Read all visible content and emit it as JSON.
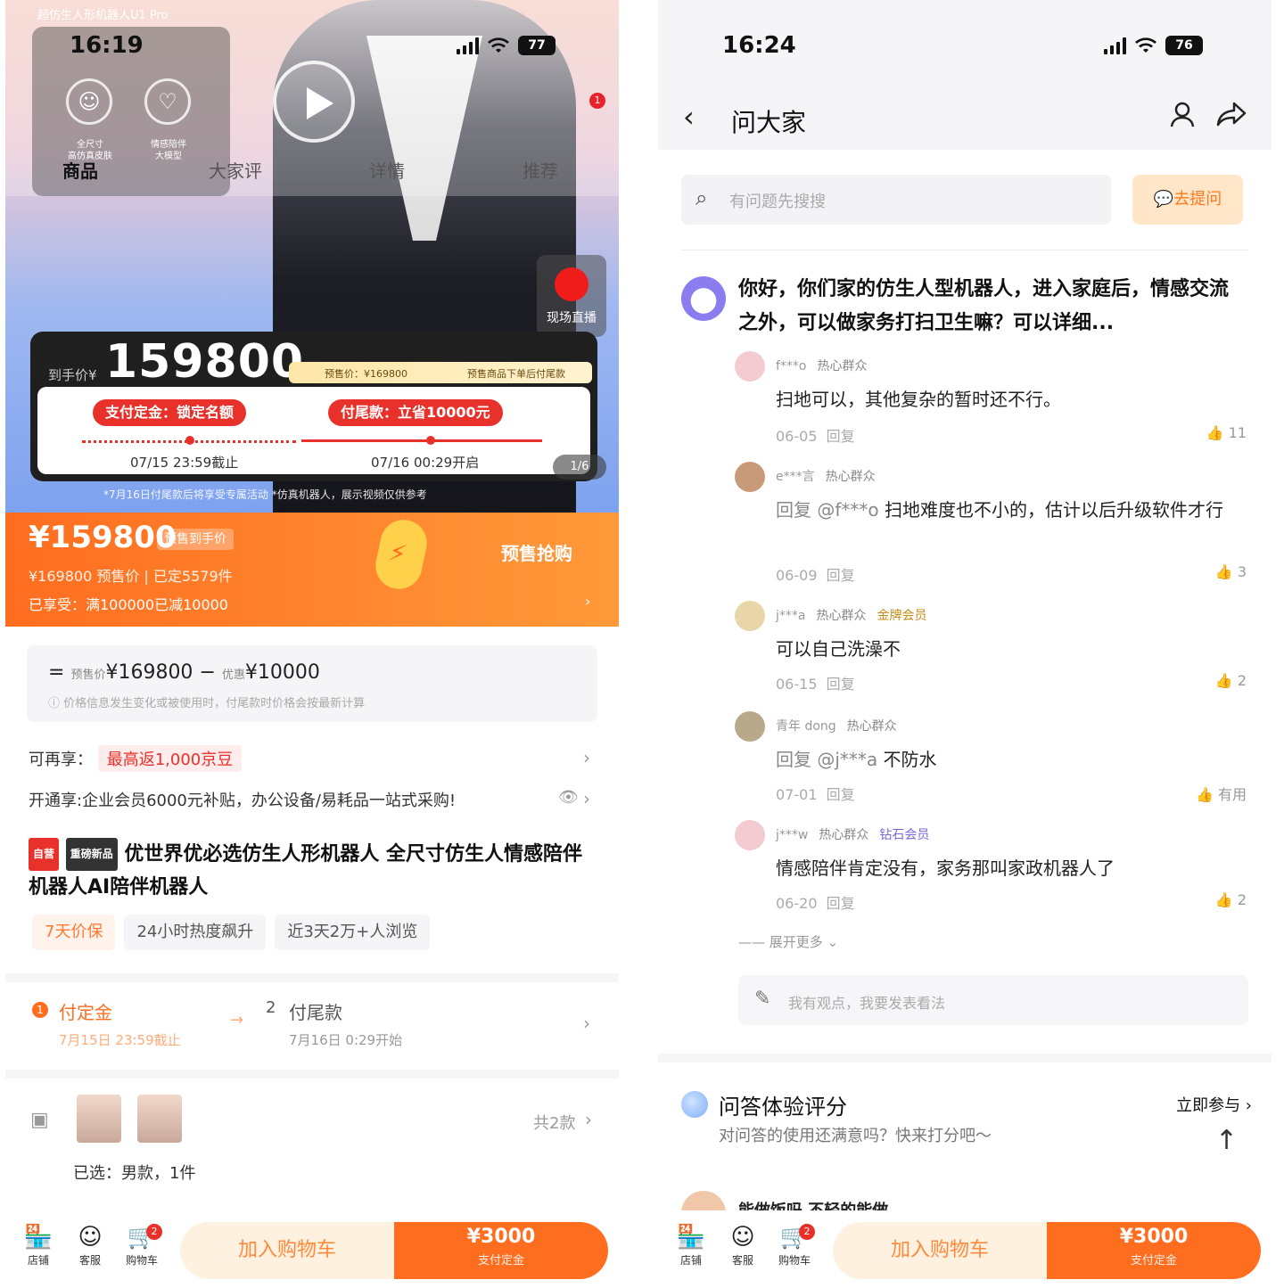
{
  "left": {
    "brand_text": "超仿生人形机器人U1 Pro",
    "status": {
      "time": "16:19",
      "battery": "77"
    },
    "mini_captions": [
      "全尺寸\n高仿真皮肤",
      "情感陪伴\n大模型"
    ],
    "tabs": [
      "商品",
      "大家评",
      "详情",
      "推荐"
    ],
    "record_label": "现场直播",
    "red_dot": "1",
    "price_card": {
      "prefix": "到手价¥",
      "price": "159800",
      "strip_left": "预售价：¥169800",
      "strip_right": "预售商品下单后付尾款",
      "step1_label": "支付定金：锁定名额",
      "step2_label": "付尾款：立省10000元",
      "step1_date": "07/15 23:59截止",
      "step2_date": "07/16 00:29开启"
    },
    "image_count": "1/6",
    "hero_notes": "*7月16日付尾款后将享受专属活动   *仿真机器人，展示视频仅供参考",
    "band": {
      "price": "¥159800",
      "tag": "预售到手价",
      "sub": "¥169800 预售价 | 已定5579件",
      "sub2": "已享受：满100000已减10000",
      "cta": "预售抢购",
      "arrow": "›"
    },
    "cost": {
      "main_prefix": "=",
      "main_label1": "预售价",
      "main_value1": "¥169800",
      "main_sep": "−",
      "main_label2": "优惠",
      "main_value2": "¥10000",
      "note": "ⓘ 价格信息发生变化或被使用时，付尾款时价格会按最新计算"
    },
    "rebate": {
      "label": "可再享：",
      "tag": "最高返1,000京豆",
      "chevron": "›"
    },
    "member": {
      "text": "开通享:企业会员6000元补贴，办公设备/易耗品一站式采购!",
      "chevron": "›"
    },
    "title": {
      "badge1": "自营",
      "badge2": "重磅新品",
      "text": "优世界优必选仿生人形机器人 全尺寸仿生人情感陪伴机器人AI陪伴机器人"
    },
    "chips": [
      "7天价保",
      "24小时热度飙升",
      "近3天2万+人浏览"
    ],
    "steps": {
      "s1_num": "1",
      "s1_title": "付定金",
      "s1_sub": "7月15日 23:59截止",
      "arrow": "→",
      "s2_num": "2",
      "s2_title": "付尾款",
      "s2_sub": "7月16日 0:29开始",
      "chevron": "›"
    },
    "sku": {
      "count": "共2款",
      "chevron": "›",
      "selected": "已选：男款，1件"
    },
    "bottom": {
      "icons": [
        {
          "label": "店铺",
          "glyph": "🏪"
        },
        {
          "label": "客服",
          "glyph": "☺"
        },
        {
          "label": "购物车",
          "glyph": "🛒"
        }
      ],
      "cart_badge": "2",
      "cart_btn": "加入购物车",
      "pay_price": "¥3000",
      "pay_sub": "支付定金"
    }
  },
  "right": {
    "status": {
      "time": "16:24",
      "battery": "76"
    },
    "nav": {
      "back": "‹",
      "title": "问大家",
      "user_icon": "user-icon",
      "share_icon": "share-icon"
    },
    "search": {
      "placeholder": "有问题先搜搜",
      "ask_label": "去提问"
    },
    "question": "你好，你们家的仿生人型机器人，进入家庭后，情感交流之外，可以做家务打扫卫生嘛？可以详细...",
    "answers": [
      {
        "user": "f***o",
        "tag": "热心群众",
        "vip": "",
        "body_reply": "",
        "body": "扫地可以，其他复杂的暂时还不行。",
        "date": "06-05",
        "reply": "回复",
        "likes": "11"
      },
      {
        "user": "e***言",
        "tag": "热心群众",
        "vip": "",
        "body_reply": "回复 @f***o",
        "body": "扫地难度也不小的，估计以后升级软件才行",
        "date": "06-09",
        "reply": "回复",
        "likes": "3"
      },
      {
        "user": "j***a",
        "tag": "热心群众",
        "vip": "金牌会员",
        "body_reply": "",
        "body": "可以自己洗澡不",
        "date": "06-15",
        "reply": "回复",
        "likes": "2"
      },
      {
        "user": "青年 dong",
        "tag": "热心群众",
        "vip": "",
        "body_reply": "回复 @j***a",
        "body": "不防水",
        "date": "07-01",
        "reply": "回复",
        "likes": "有用"
      },
      {
        "user": "j***w",
        "tag": "热心群众",
        "vip2": "钻石会员",
        "body_reply": "",
        "body": "情感陪伴肯定没有，家务那叫家政机器人了",
        "date": "06-20",
        "reply": "回复",
        "likes": "2"
      }
    ],
    "expand": "—— 展开更多 ⌄",
    "opinion_placeholder": "我有观点，我要发表看法",
    "rate": {
      "title": "问答体验评分",
      "sub": "对问答的使用还满意吗？快来打分吧～",
      "go": "立即参与 ›"
    },
    "next_peek": "能做饭吗   不轻的能做",
    "bottom": {
      "icons": [
        {
          "label": "店铺",
          "glyph": "🏪"
        },
        {
          "label": "客服",
          "glyph": "☺"
        },
        {
          "label": "购物车",
          "glyph": "🛒"
        }
      ],
      "cart_badge": "2",
      "cart_btn": "加入购物车",
      "pay_price": "¥3000",
      "pay_sub": "支付定金"
    }
  }
}
